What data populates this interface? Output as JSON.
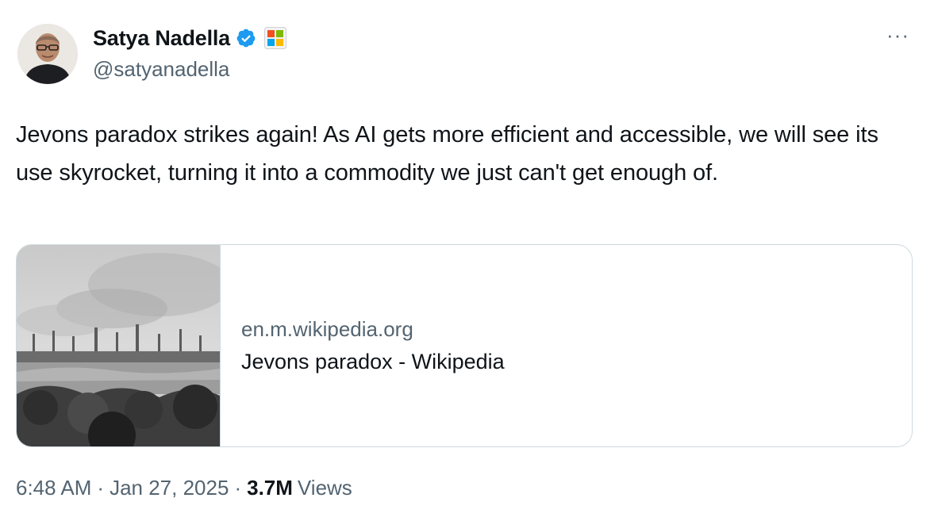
{
  "author": {
    "display_name": "Satya Nadella",
    "handle": "@satyanadella",
    "avatar_icon": "profile-photo",
    "verified_icon": "verified-badge-icon",
    "verified_color": "#1d9bf0",
    "affiliation_icon": "microsoft-logo-icon"
  },
  "more_options_icon": "ellipsis-icon",
  "more_options_glyph": "···",
  "tweet": {
    "text": "Jevons paradox strikes again! As AI gets more efficient and accessible, we will see its use skyrocket, turning it into a commodity we just can't get enough of."
  },
  "link_card": {
    "image_icon": "industrial-landscape-engraving",
    "domain": "en.m.wikipedia.org",
    "title": "Jevons paradox - Wikipedia"
  },
  "meta": {
    "time": "6:48 AM",
    "date": "Jan 27, 2025",
    "separator": "·",
    "views_count": "3.7M",
    "views_label": "Views"
  },
  "colors": {
    "text": "#0f1419",
    "secondary": "#536471",
    "border": "#cfd9de"
  }
}
